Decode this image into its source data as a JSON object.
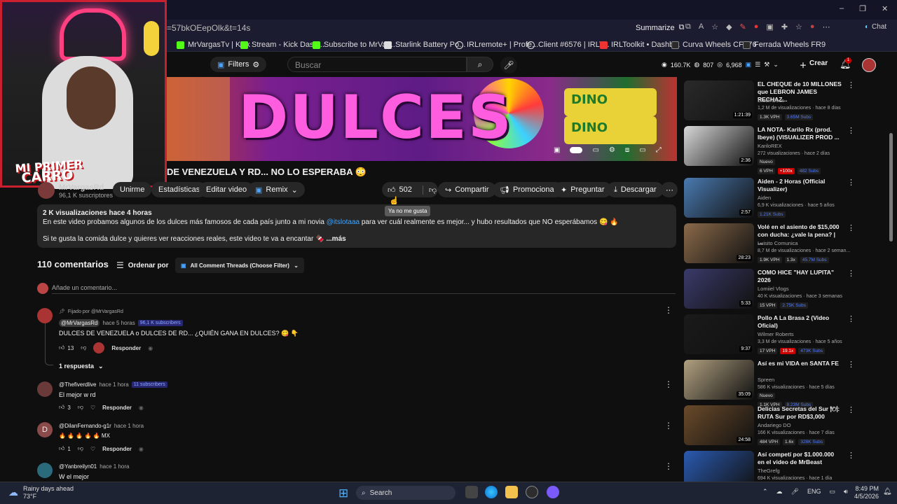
{
  "browser": {
    "url": "=57bkOEepOlk&t=14s",
    "summarize": "Summarize",
    "chat": "Chat",
    "bookmarks": [
      "MrVargasTv | Kick",
      "Stream - Kick Dash...",
      "Subscribe to MrVar...",
      "Starlink Battery Po...",
      "IRLremote+ | Profe...",
      "Client #6576 | IRLT...",
      "IRLToolkit • Dashb...",
      "Curva Wheels CFF76",
      "Ferrada Wheels FR9"
    ]
  },
  "youtube": {
    "filters": "Filters",
    "search_placeholder": "Buscar",
    "stats": [
      "160.7K",
      "807",
      "6,968"
    ],
    "create": "Crear",
    "notif_count": "1"
  },
  "banner": {
    "text": "DULCES",
    "sticker": "DINO"
  },
  "webcam": {
    "logo_line1": "MI PRIMER",
    "logo_line2": "CARRO"
  },
  "video": {
    "title": "DE VENEZUELA Y RD... NO LO ESPERABA 😳",
    "channel": "MrVargasRd",
    "subs": "96,1 K suscriptores",
    "unirme": "Unirme",
    "estadisticas": "Estadísticas",
    "editar": "Editar video",
    "remix": "Remix",
    "likes": "502",
    "compartir": "Compartir",
    "promocionar": "Promocionar",
    "preguntar": "Preguntar",
    "descargar": "Descargar",
    "tooltip": "Ya no me gusta"
  },
  "description": {
    "meta": "2 K visualizaciones  hace 4 horas",
    "line1_pre": "En este video probamos algunos de los dulces más famosos de cada país junto a mi novia ",
    "line1_link": "@itslotaaa",
    "line1_post": " para ver cuál realmente es mejor... y hubo resultados que NO esperábamos 😋 🔥",
    "line2": "Si te gusta la comida dulce y quieres ver reacciones reales, este video te va a encantar 🍫",
    "more": "...más"
  },
  "comments": {
    "count": "110 comentarios",
    "sort": "Ordenar por",
    "threads": "All Comment Threads (Choose Filter)",
    "add": "Añade un comentario...",
    "pinned_label": "Fijado por @MrVargasRd",
    "reply_label": "Responder",
    "replies_toggle": "1 respuesta",
    "items": [
      {
        "author": "@MrVargasRd",
        "time": "hace 5 horas",
        "badge": "96,1 K subscribers",
        "text": "DULCES DE VENEZUELA o DULCES DE RD... ¿QUIÉN GANA EN DULCES? 😋 👇",
        "likes": "13",
        "color": "#a33"
      },
      {
        "author": "@Thefiverdlive",
        "time": "hace 1 hora",
        "badge": "11 subscribers",
        "text": "El mejor w rd",
        "likes": "3",
        "color": "#6a3a3a"
      },
      {
        "author": "@DilanFernando-g1r",
        "time": "hace 1 hora",
        "badge": "",
        "text": "🔥 🔥 🔥 🔥 🔥 MX",
        "likes": "1",
        "color": "#8a4a4a",
        "initial": "D"
      },
      {
        "author": "@Yanbreilyn01",
        "time": "hace 1 hora",
        "badge": "",
        "text": "W el mejor",
        "likes": "",
        "color": "#2a6a7a"
      }
    ]
  },
  "sidebar": [
    {
      "title": "EL CHEQUE de 10 MILLONES que LEBRON JAMES RECHAZ...",
      "channel": "Dieck Docs",
      "stats": "1,2 M de visualizaciones · hace 8 días",
      "dur": "1:21:39",
      "tags": [
        "1.3K VPH",
        "3.65M Subs"
      ],
      "color": "#2a2a2a"
    },
    {
      "title": "LA NOTA- Karilo Rx (prod. lbeye) (VISUALIZER PROD ...",
      "channel": "KariloREX",
      "stats": "272 visualizaciones · hace 2 días",
      "dur": "2:36",
      "new": "Nuevo",
      "tags": [
        "6 VPH",
        "+100x",
        "482 Subs"
      ],
      "color": "#d8d8d8"
    },
    {
      "title": "Aiden - 2 Horas (Official Visualizer)",
      "channel": "Aiden",
      "stats": "6,9 K visualizaciones · hace 5 años",
      "dur": "2:57",
      "tags": [
        "1.21K Subs"
      ],
      "color": "#4a7ab0"
    },
    {
      "title": "Volé en el asiento de $15,000 con ducha: ¿vale la pena? | ...",
      "channel": "Luisito Comunica",
      "stats": "8,7 M de visualizaciones · hace 2 seman...",
      "dur": "28:23",
      "tags": [
        "1.9K VPH",
        "1.3x",
        "45.7M Subs"
      ],
      "color": "#8a6a4a"
    },
    {
      "title": "COMO HICE \"HAY LUPITA\" 2026",
      "channel": "Lomiiel Vlogs",
      "stats": "40 K visualizaciones · hace 3 semanas",
      "dur": "5:33",
      "tags": [
        "15 VPH",
        "2.75K Subs"
      ],
      "color": "#3a3a6a"
    },
    {
      "title": "Pollo A La Brasa 2 (Video Oficial)",
      "channel": "Wilmer Roberts",
      "stats": "3,3 M de visualizaciones · hace 5 años",
      "dur": "9:37",
      "tags": [
        "17 VPH",
        "19.1x",
        "473K Subs"
      ],
      "color": "#1a1a1a"
    },
    {
      "title": "Así es mi VIDA en SANTA FE",
      "channel": "Spreen",
      "stats": "586 K visualizaciones · hace 5 días",
      "dur": "35:09",
      "new": "Nuevo",
      "tags": [
        "1.1K VPH",
        "8.23M Subs"
      ],
      "color": "#b0a080"
    },
    {
      "title": "Delicias Secretas del Sur 🍽: RUTA Sur por RD$3,000",
      "channel": "Andariego DO",
      "stats": "166 K visualizaciones · hace 7 días",
      "dur": "24:58",
      "tags": [
        "484 VPH",
        "1.6x",
        "328K Subs"
      ],
      "color": "#6a4a2a"
    },
    {
      "title": "Así competí por $1.000.000 en el video de MrBeast",
      "channel": "TheGrefg",
      "stats": "694 K visualizaciones · hace 1 día",
      "dur": "",
      "tags": [],
      "color": "#2a5ab0"
    }
  ],
  "taskbar": {
    "weather_title": "Rainy days ahead",
    "weather_temp": "73°F",
    "search": "Search",
    "lang": "ENG",
    "time": "8:49 PM",
    "date": "4/5/2026"
  }
}
